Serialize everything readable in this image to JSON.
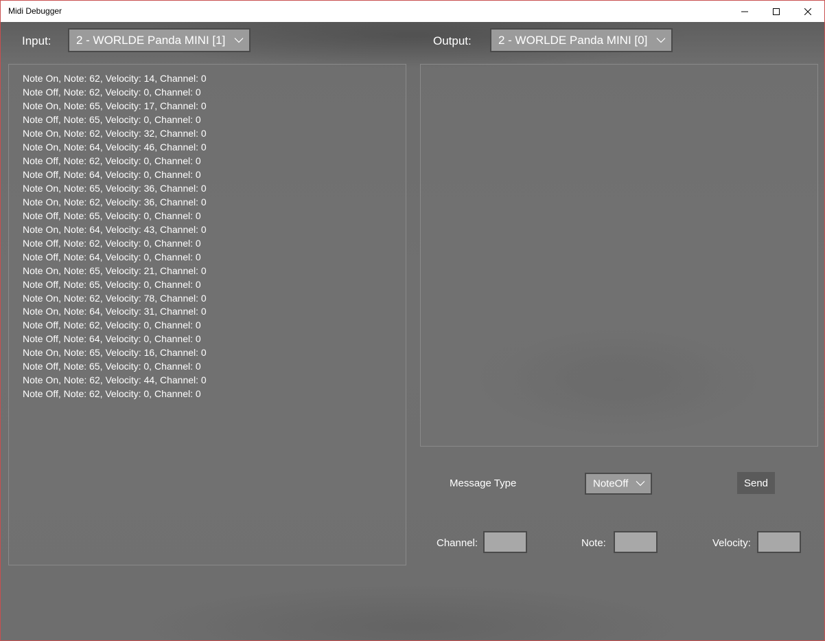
{
  "window": {
    "title": "Midi Debugger"
  },
  "input": {
    "label": "Input:",
    "selected_device": "2 - WORLDE Panda MINI [1]",
    "messages": [
      "Note On, Note: 62, Velocity: 14, Channel: 0",
      "Note Off, Note: 62, Velocity: 0, Channel: 0",
      "Note On, Note: 65, Velocity: 17, Channel: 0",
      "Note Off, Note: 65, Velocity: 0, Channel: 0",
      "Note On, Note: 62, Velocity: 32, Channel: 0",
      "Note On, Note: 64, Velocity: 46, Channel: 0",
      "Note Off, Note: 62, Velocity: 0, Channel: 0",
      "Note Off, Note: 64, Velocity: 0, Channel: 0",
      "Note On, Note: 65, Velocity: 36, Channel: 0",
      "Note On, Note: 62, Velocity: 36, Channel: 0",
      "Note Off, Note: 65, Velocity: 0, Channel: 0",
      "Note On, Note: 64, Velocity: 43, Channel: 0",
      "Note Off, Note: 62, Velocity: 0, Channel: 0",
      "Note Off, Note: 64, Velocity: 0, Channel: 0",
      "Note On, Note: 65, Velocity: 21, Channel: 0",
      "Note Off, Note: 65, Velocity: 0, Channel: 0",
      "Note On, Note: 62, Velocity: 78, Channel: 0",
      "Note On, Note: 64, Velocity: 31, Channel: 0",
      "Note Off, Note: 62, Velocity: 0, Channel: 0",
      "Note Off, Note: 64, Velocity: 0, Channel: 0",
      "Note On, Note: 65, Velocity: 16, Channel: 0",
      "Note Off, Note: 65, Velocity: 0, Channel: 0",
      "Note On, Note: 62, Velocity: 44, Channel: 0",
      "Note Off, Note: 62, Velocity: 0, Channel: 0"
    ]
  },
  "output": {
    "label": "Output:",
    "selected_device": "2 - WORLDE Panda MINI [0]"
  },
  "send_form": {
    "message_type_label": "Message Type",
    "message_type_value": "NoteOff",
    "send_label": "Send",
    "channel_label": "Channel:",
    "channel_value": "",
    "note_label": "Note:",
    "note_value": "",
    "velocity_label": "Velocity:",
    "velocity_value": ""
  },
  "colors": {
    "window_border": "#c94f4f",
    "background": "#6f6f6f",
    "combo_fill": "#9b9b9b",
    "textbox_fill": "#a8a8a8",
    "send_button": "#5a5a5a"
  },
  "icons": {
    "minimize": "minimize-icon",
    "maximize": "maximize-icon",
    "close": "close-icon",
    "dropdown": "chevron-down-icon"
  }
}
